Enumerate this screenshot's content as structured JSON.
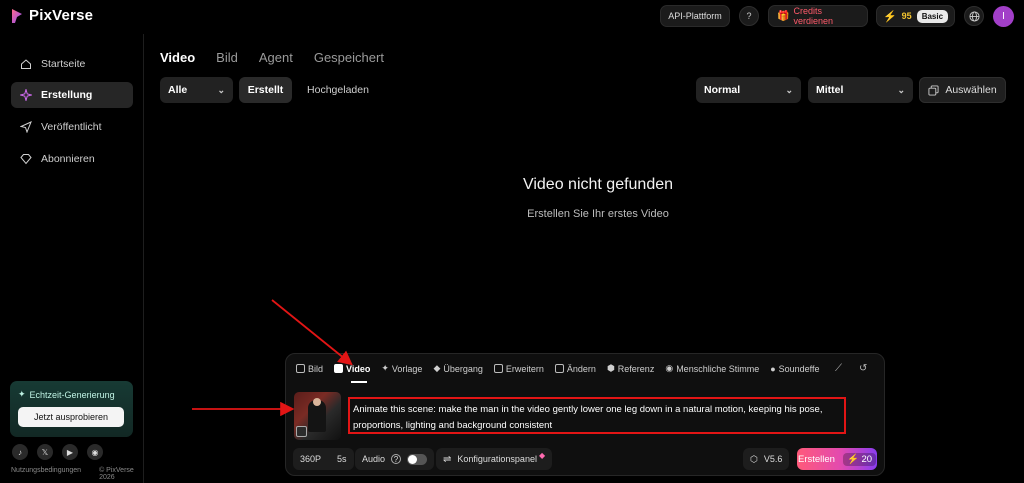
{
  "brand": {
    "name": "PixVerse"
  },
  "header": {
    "api_label": "API-Plattform",
    "credits_earn_label": "Credits verdienen",
    "energy_count": "95",
    "plan_badge": "Basic",
    "avatar_initial": "I"
  },
  "sidebar": {
    "items": [
      {
        "label": "Startseite",
        "icon": "home-icon"
      },
      {
        "label": "Erstellung",
        "icon": "sparkle-icon"
      },
      {
        "label": "Veröffentlicht",
        "icon": "send-icon"
      },
      {
        "label": "Abonnieren",
        "icon": "diamond-icon"
      }
    ],
    "promo_title": "Echtzeit-Generierung",
    "promo_button": "Jetzt ausprobieren",
    "footer_terms": "Nutzungsbedingungen",
    "footer_copyright": "© PixVerse 2026"
  },
  "main": {
    "tabs": [
      "Video",
      "Bild",
      "Agent",
      "Gespeichert"
    ],
    "filter_all": "Alle",
    "filter_created": "Erstellt",
    "filter_uploaded": "Hochgeladen",
    "sort_normal": "Normal",
    "sort_medium": "Mittel",
    "select_label": "Auswählen",
    "empty_title": "Video nicht gefunden",
    "empty_subtitle": "Erstellen Sie Ihr erstes Video"
  },
  "composer": {
    "modes": [
      "Bild",
      "Video",
      "Vorlage",
      "Übergang",
      "Erweitern",
      "Ändern",
      "Referenz",
      "Menschliche Stimme",
      "Soundeffe"
    ],
    "prompt_text": "Animate this scene: make the man in the video gently lower one leg down in a natural motion, keeping his pose, proportions, lighting and background consistent",
    "resolution": "360P",
    "duration": "5s",
    "audio_label": "Audio",
    "config_label": "Konfigurationspanel",
    "model_version": "V5.6",
    "create_label": "Erstellen",
    "create_cost": "20"
  },
  "colors": {
    "accent_red": "#e21515",
    "credits_red": "#ff5a6a",
    "energy_yellow": "#f3c42f",
    "promo_green": "#173a34"
  }
}
